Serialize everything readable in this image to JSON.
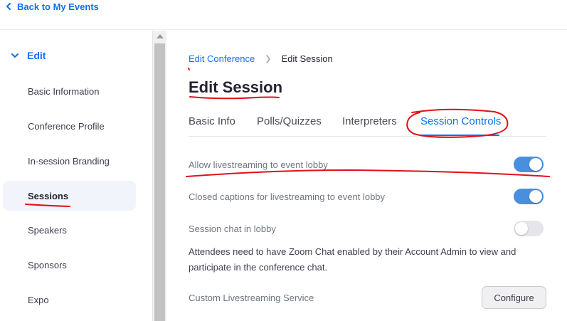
{
  "header": {
    "back_label": "Back to My Events"
  },
  "sidebar": {
    "section_label": "Edit",
    "items": [
      {
        "label": "Basic Information"
      },
      {
        "label": "Conference Profile"
      },
      {
        "label": "In-session Branding"
      },
      {
        "label": "Sessions"
      },
      {
        "label": "Speakers"
      },
      {
        "label": "Sponsors"
      },
      {
        "label": "Expo"
      }
    ],
    "active_index": 3
  },
  "breadcrumb": {
    "parent": "Edit Conference",
    "current": "Edit Session"
  },
  "page_title": "Edit Session",
  "tabs": [
    {
      "label": "Basic Info"
    },
    {
      "label": "Polls/Quizzes"
    },
    {
      "label": "Interpreters"
    },
    {
      "label": "Session Controls"
    }
  ],
  "active_tab": "Session Controls",
  "settings": [
    {
      "label": "Allow livestreaming to event lobby",
      "enabled": true
    },
    {
      "label": "Closed captions for livestreaming to event lobby",
      "enabled": true
    },
    {
      "label": "Session chat in lobby",
      "enabled": false
    }
  ],
  "chat_note": "Attendees need to have Zoom Chat enabled by their Account Admin to view and participate in the conference chat.",
  "custom_livestream": {
    "label": "Custom Livestreaming Service",
    "button_label": "Configure"
  },
  "colors": {
    "accent": "#0e71eb",
    "toggle_on": "#4a8fde",
    "annotation": "#e0101a"
  }
}
